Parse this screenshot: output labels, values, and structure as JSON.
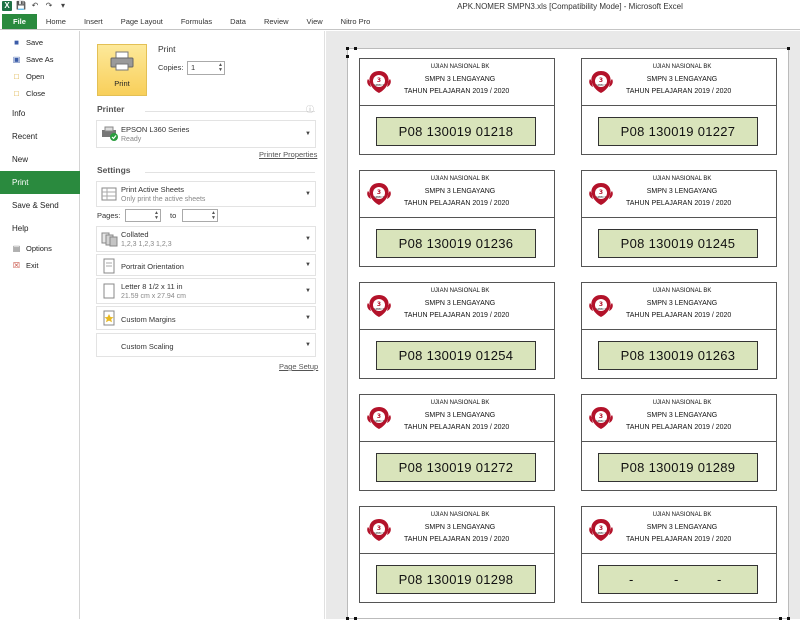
{
  "window": {
    "title": "APK.NOMER SMPN3.xls  [Compatibility Mode]  -  Microsoft Excel"
  },
  "ribbon": {
    "tabs": [
      "File",
      "Home",
      "Insert",
      "Page Layout",
      "Formulas",
      "Data",
      "Review",
      "View",
      "Nitro Pro"
    ]
  },
  "backstage": {
    "items": [
      {
        "label": "Save",
        "icon": "save-icon"
      },
      {
        "label": "Save As",
        "icon": "save-as-icon"
      },
      {
        "label": "Open",
        "icon": "open-folder-icon"
      },
      {
        "label": "Close",
        "icon": "close-file-icon"
      },
      {
        "label": "Info"
      },
      {
        "label": "Recent"
      },
      {
        "label": "New"
      },
      {
        "label": "Print"
      },
      {
        "label": "Save & Send"
      },
      {
        "label": "Help"
      },
      {
        "label": "Options",
        "icon": "options-icon"
      },
      {
        "label": "Exit",
        "icon": "exit-icon"
      }
    ],
    "active": "Print"
  },
  "print": {
    "heading": "Print",
    "button_label": "Print",
    "copies_label": "Copies:",
    "copies_value": "1"
  },
  "printer": {
    "heading": "Printer",
    "name": "EPSON L360 Series",
    "status": "Ready",
    "properties_link": "Printer Properties"
  },
  "settings": {
    "heading": "Settings",
    "print_what": {
      "main": "Print Active Sheets",
      "sub": "Only print the active sheets"
    },
    "pages_label": "Pages:",
    "to_label": "to",
    "collation": {
      "main": "Collated",
      "sub": "1,2,3    1,2,3    1,2,3"
    },
    "orientation": "Portrait Orientation",
    "paper": {
      "main": "Letter 8 1/2 x 11 in",
      "sub": "21.59 cm x 27.94 cm"
    },
    "margins": "Custom Margins",
    "scaling": "Custom Scaling",
    "page_setup_link": "Page Setup"
  },
  "preview": {
    "cards": [
      {
        "line1": "UJIAN NASIONAL BK",
        "line2": "SMPN 3 LENGAYANG",
        "line3": "TAHUN PELAJARAN  2019 / 2020",
        "number": "P08 130019 01218"
      },
      {
        "line1": "UJIAN NASIONAL BK",
        "line2": "SMPN 3 LENGAYANG",
        "line3": "TAHUN PELAJARAN  2019 / 2020",
        "number": "P08 130019 01227"
      },
      {
        "line1": "UJIAN NASIONAL BK",
        "line2": "SMPN 3 LENGAYANG",
        "line3": "TAHUN PELAJARAN  2019 / 2020",
        "number": "P08 130019 01236"
      },
      {
        "line1": "UJIAN NASIONAL BK",
        "line2": "SMPN 3 LENGAYANG",
        "line3": "TAHUN PELAJARAN  2019 / 2020",
        "number": "P08 130019 01245"
      },
      {
        "line1": "UJIAN NASIONAL BK",
        "line2": "SMPN 3 LENGAYANG",
        "line3": "TAHUN PELAJARAN  2019 / 2020",
        "number": "P08 130019 01254"
      },
      {
        "line1": "UJIAN NASIONAL BK",
        "line2": "SMPN 3 LENGAYANG",
        "line3": "TAHUN PELAJARAN  2019 / 2020",
        "number": "P08 130019 01263"
      },
      {
        "line1": "UJIAN NASIONAL BK",
        "line2": "SMPN 3 LENGAYANG",
        "line3": "TAHUN PELAJARAN  2019 / 2020",
        "number": "P08 130019 01272"
      },
      {
        "line1": "UJIAN NASIONAL BK",
        "line2": "SMPN 3 LENGAYANG",
        "line3": "TAHUN PELAJARAN  2019 / 2020",
        "number": "P08 130019 01289"
      },
      {
        "line1": "UJIAN NASIONAL BK",
        "line2": "SMPN 3 LENGAYANG",
        "line3": "TAHUN PELAJARAN  2019 / 2020",
        "number": "P08 130019 01298"
      },
      {
        "line1": "UJIAN NASIONAL BK",
        "line2": "SMPN 3 LENGAYANG",
        "line3": "TAHUN PELAJARAN  2019 / 2020",
        "number": "",
        "blank_marks": [
          "-",
          "-",
          "-"
        ]
      }
    ],
    "logo_text": "SMPN 3"
  },
  "colors": {
    "file_green": "#2a8a3e",
    "number_fill": "#d9e4bb",
    "logo_red": "#b3122a"
  }
}
